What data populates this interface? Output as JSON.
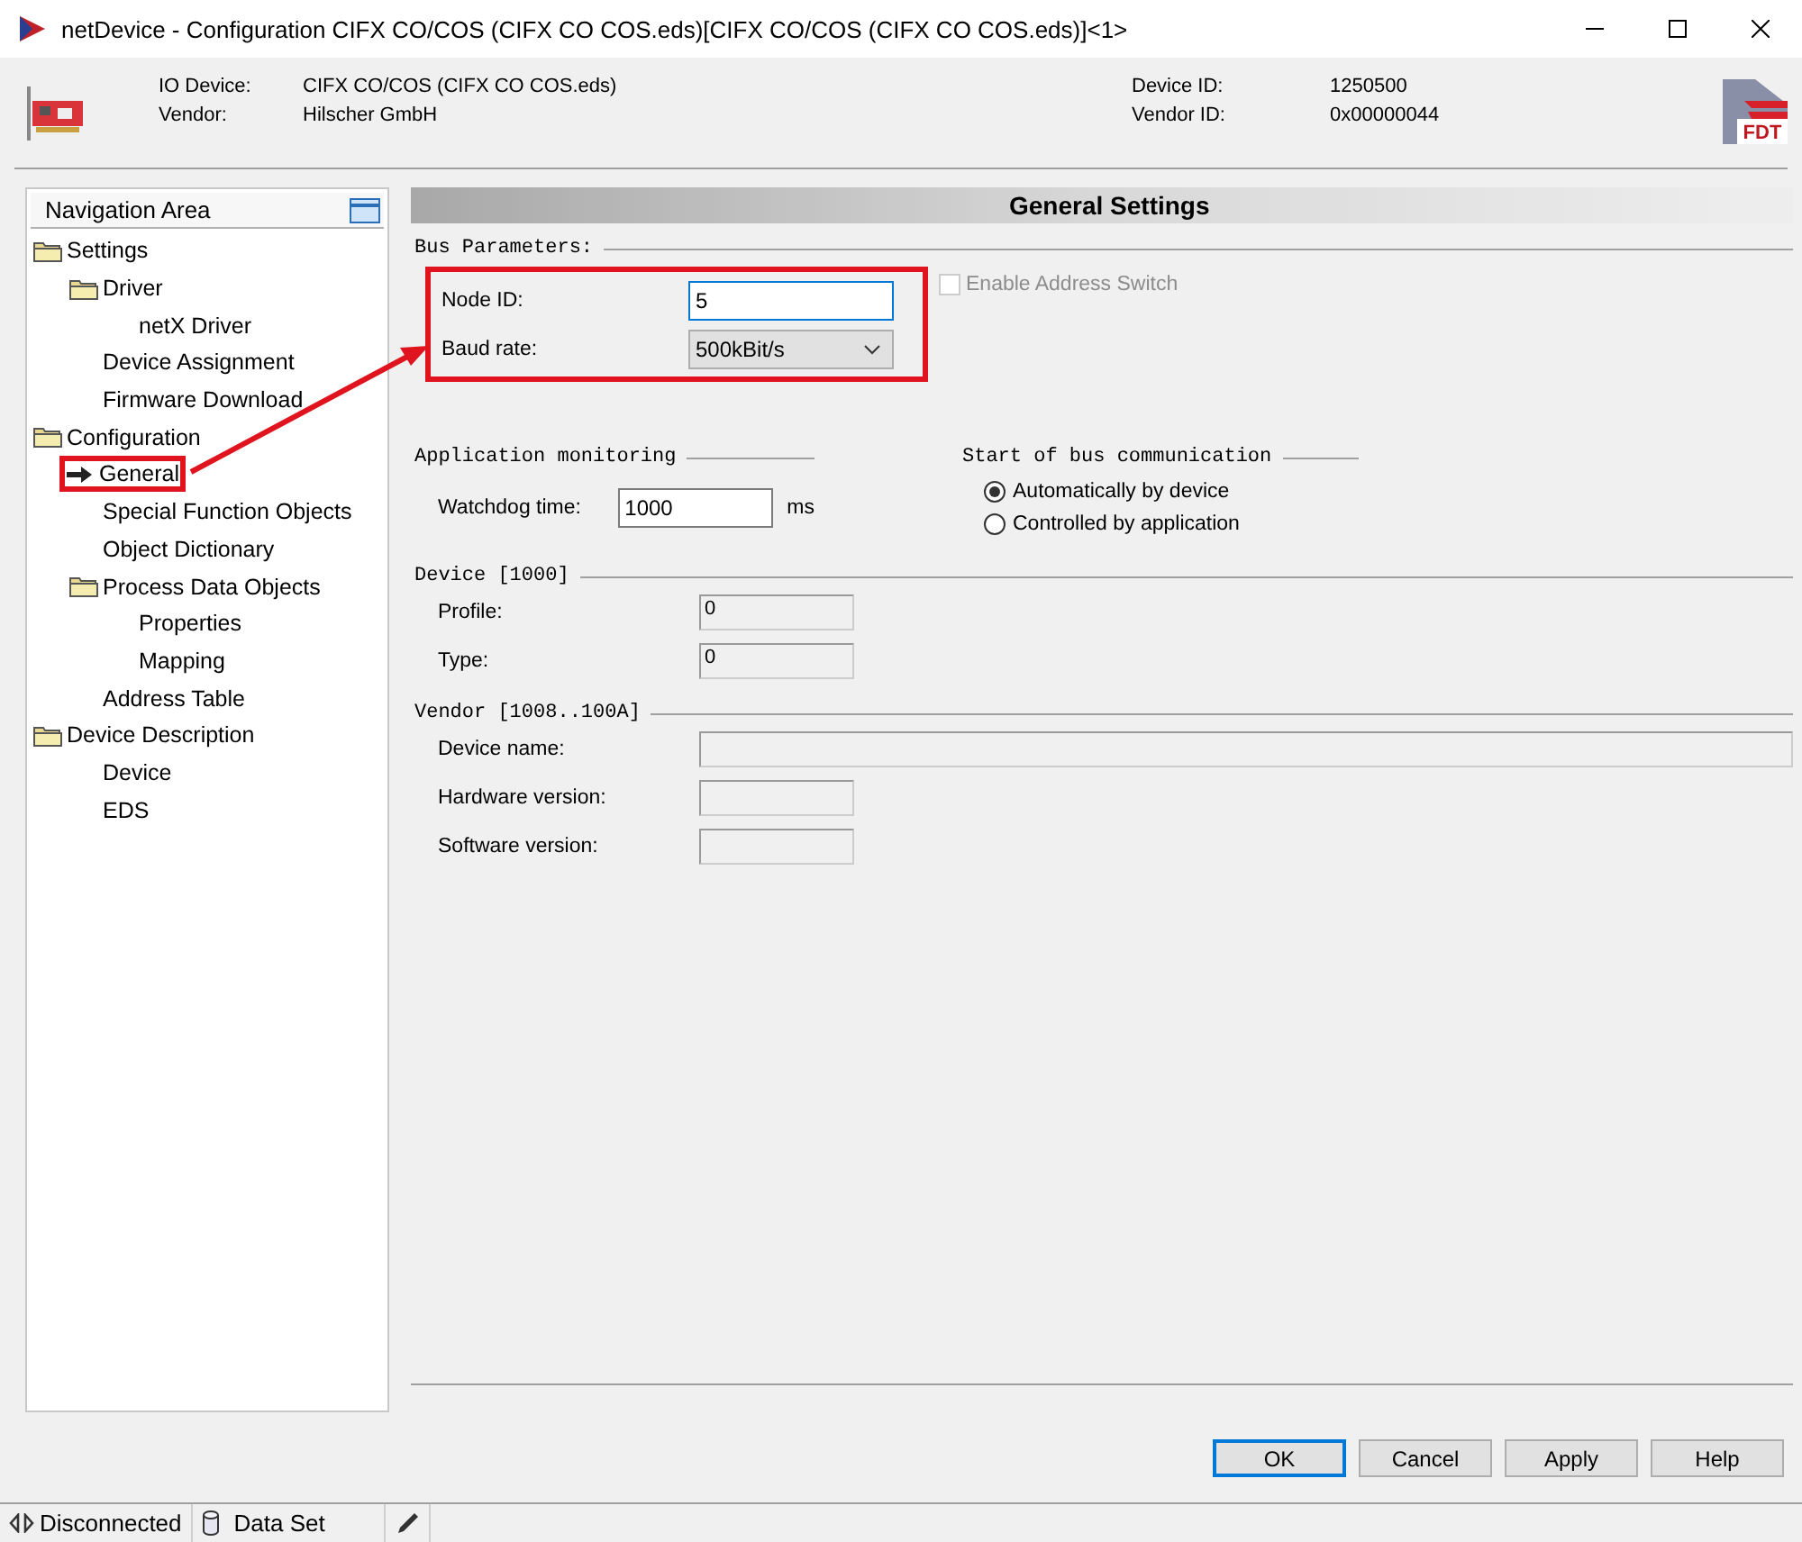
{
  "window": {
    "title": "netDevice - Configuration CIFX CO/COS (CIFX CO COS.eds)[CIFX CO/COS (CIFX CO COS.eds)]<1>"
  },
  "header": {
    "left": [
      {
        "label": "IO Device:",
        "value": "CIFX CO/COS (CIFX CO COS.eds)"
      },
      {
        "label": "Vendor:",
        "value": "Hilscher GmbH"
      }
    ],
    "right": [
      {
        "label": "Device ID:",
        "value": "1250500"
      },
      {
        "label": "Vendor ID:",
        "value": "0x00000044"
      }
    ],
    "logo_text": "FDT"
  },
  "navigation": {
    "title": "Navigation Area",
    "items": [
      {
        "label": "Settings",
        "selected": false,
        "children": [
          {
            "label": "Driver",
            "selected": false,
            "children": [
              {
                "label": "netX Driver",
                "selected": false
              }
            ]
          },
          {
            "label": "Device Assignment",
            "selected": false
          },
          {
            "label": "Firmware Download",
            "selected": false
          }
        ]
      },
      {
        "label": "Configuration",
        "selected": false,
        "children": [
          {
            "label": "General",
            "selected": true
          },
          {
            "label": "Special Function Objects",
            "selected": false
          },
          {
            "label": "Object Dictionary",
            "selected": false
          },
          {
            "label": "Process Data Objects",
            "selected": false,
            "children": [
              {
                "label": "Properties",
                "selected": false
              },
              {
                "label": "Mapping",
                "selected": false
              }
            ]
          },
          {
            "label": "Address Table",
            "selected": false
          }
        ]
      },
      {
        "label": "Device Description",
        "selected": false,
        "children": [
          {
            "label": "Device",
            "selected": false
          },
          {
            "label": "EDS",
            "selected": false
          }
        ]
      }
    ]
  },
  "annotation": {
    "shown": true
  },
  "panel": {
    "title": "General Settings",
    "bus_parameters": {
      "title": "Bus Parameters:",
      "node_id": {
        "label": "Node ID:",
        "value": "5"
      },
      "baud_rate": {
        "label": "Baud rate:",
        "value": "500kBit/s"
      },
      "address_switch": {
        "label": "Enable Address Switch",
        "checked": false,
        "disabled": true
      }
    },
    "application_monitoring": {
      "title": "Application monitoring",
      "label": "Watchdog time:",
      "value": "1000",
      "unit": "ms"
    },
    "bus_start": {
      "title": "Start of bus communication",
      "options": [
        {
          "label": "Automatically by device",
          "selected": true
        },
        {
          "label": "Controlled by application",
          "selected": false
        }
      ]
    },
    "device": {
      "title": "Device [1000]",
      "fields": [
        {
          "label": "Profile:",
          "value": "0"
        },
        {
          "label": "Type:",
          "value": "0"
        }
      ]
    },
    "vendor": {
      "title": "Vendor [1008..100A]",
      "fields": [
        {
          "label": "Device name:",
          "kind": "wide"
        },
        {
          "label": "Hardware version:",
          "kind": "short"
        },
        {
          "label": "Software version:",
          "kind": "short"
        }
      ]
    }
  },
  "buttons": [
    {
      "label": "OK",
      "default": true
    },
    {
      "label": "Cancel",
      "default": false
    },
    {
      "label": "Apply",
      "default": false
    },
    {
      "label": "Help",
      "default": false
    }
  ],
  "status_bar": [
    {
      "kind": "connection",
      "label": "Disconnected"
    },
    {
      "kind": "dataset",
      "label": "Data Set"
    },
    {
      "kind": "edit"
    }
  ]
}
